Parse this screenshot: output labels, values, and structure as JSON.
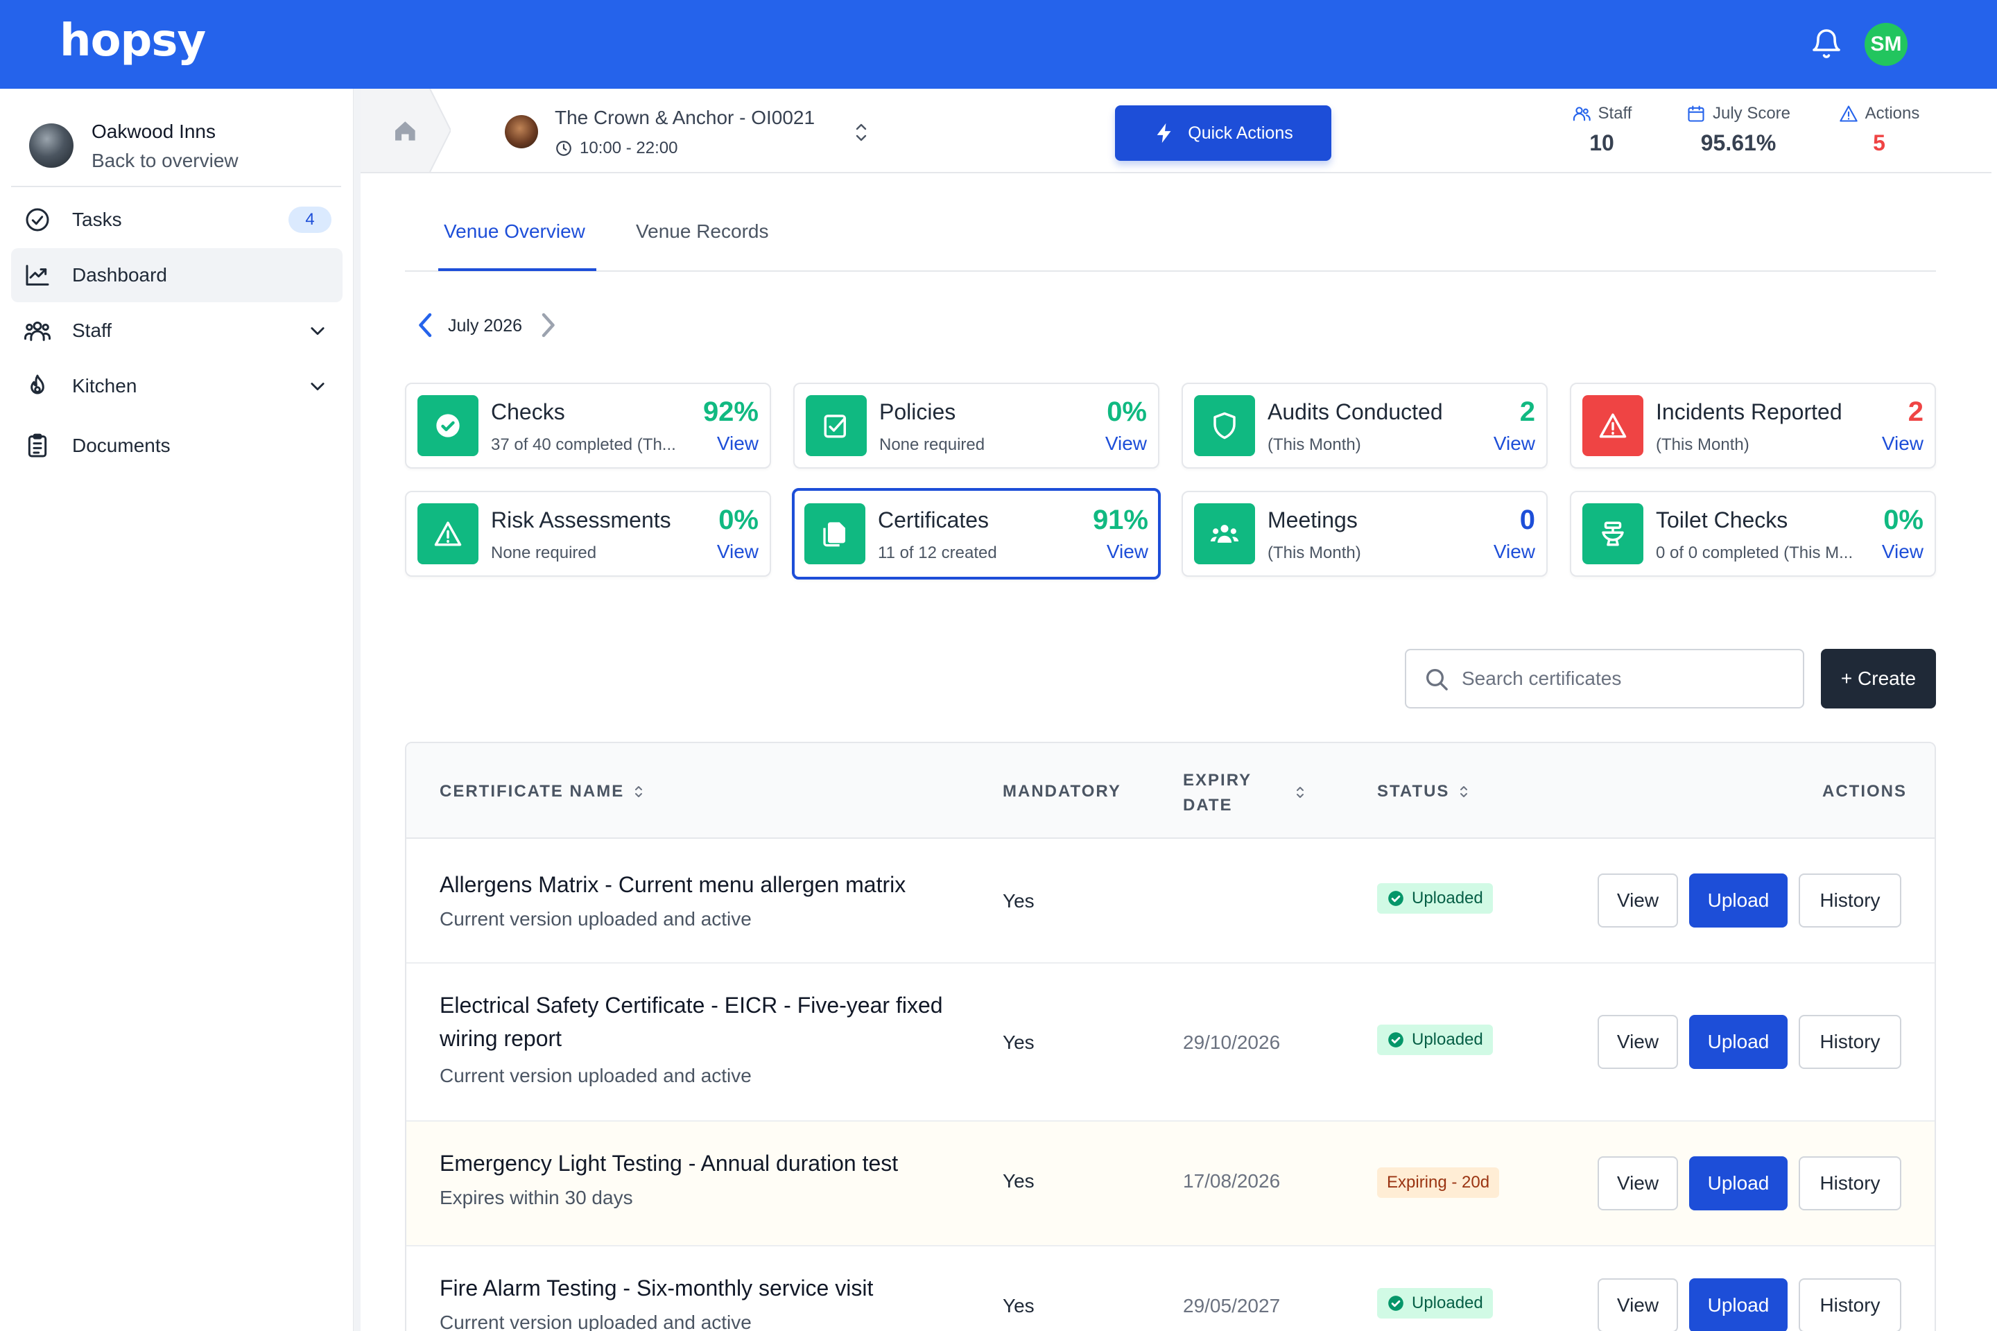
{
  "app": {
    "logo": "hopsy"
  },
  "topbar": {
    "user_initials": "SM"
  },
  "sidebar": {
    "org_name": "Oakwood Inns",
    "back_label": "Back to overview",
    "items": [
      {
        "label": "Tasks",
        "icon": "check-circle-icon",
        "badge": "4"
      },
      {
        "label": "Dashboard",
        "icon": "chart-line-icon"
      },
      {
        "label": "Staff",
        "icon": "users-icon"
      },
      {
        "label": "Kitchen",
        "icon": "flame-icon"
      },
      {
        "label": "Documents",
        "icon": "clipboard-icon"
      }
    ]
  },
  "venue": {
    "name": "The Crown & Anchor - OI0021",
    "hours": "10:00 - 22:00",
    "quick_actions_label": "Quick Actions",
    "stats": [
      {
        "label": "Staff",
        "value": "10",
        "icon": "users-icon"
      },
      {
        "label": "July Score",
        "value": "95.61%",
        "icon": "calendar-icon"
      },
      {
        "label": "Actions",
        "value": "5",
        "icon": "warning-icon",
        "color": "#ef4444"
      }
    ]
  },
  "tabs": [
    {
      "label": "Venue Overview",
      "active": true
    },
    {
      "label": "Venue Records",
      "active": false
    }
  ],
  "month_label": "July 2026",
  "cards": [
    {
      "title": "Checks",
      "subtitle": "37 of 40 completed (Th...",
      "value": "92%",
      "link": "View",
      "icon": "check-badge-icon",
      "color": "#10b981"
    },
    {
      "title": "Policies",
      "subtitle": "None required",
      "value": "0%",
      "link": "View",
      "icon": "checklist-icon",
      "color": "#10b981"
    },
    {
      "title": "Audits Conducted",
      "subtitle": "(This Month)",
      "value": "2",
      "link": "View",
      "icon": "shield-icon",
      "color": "#10b981"
    },
    {
      "title": "Incidents Reported",
      "subtitle": "(This Month)",
      "value": "2",
      "link": "View",
      "icon": "alert-icon",
      "color": "#ef4444"
    },
    {
      "title": "Risk Assessments",
      "subtitle": "None required",
      "value": "0%",
      "link": "View",
      "icon": "alert-icon",
      "color": "#10b981"
    },
    {
      "title": "Certificates",
      "subtitle": "11 of 12 created",
      "value": "91%",
      "link": "View",
      "icon": "documents-icon",
      "color": "#10b981"
    },
    {
      "title": "Meetings",
      "subtitle": "(This Month)",
      "value": "0",
      "link": "View",
      "icon": "group-icon",
      "color": "#10b981"
    },
    {
      "title": "Toilet Checks",
      "subtitle": "0 of 0 completed (This M...",
      "value": "0%",
      "link": "View",
      "icon": "toilet-icon",
      "color": "#10b981"
    }
  ],
  "search": {
    "placeholder": "Search certificates"
  },
  "create_label": "+ Create",
  "table": {
    "headers": {
      "name": "CERTIFICATE NAME",
      "mandatory": "MANDATORY",
      "expiry_line1": "EXPIRY",
      "expiry_line2": "DATE",
      "status": "STATUS",
      "actions": "ACTIONS"
    },
    "rows": [
      {
        "name": "Allergens Matrix - Current menu allergen matrix",
        "desc": "Current version uploaded and active",
        "mandatory": "Yes",
        "expiry": "",
        "status": "Uploaded",
        "status_type": "ok"
      },
      {
        "name": "Electrical Safety Certificate - EICR - Five-year fixed wiring report",
        "desc": "Current version uploaded and active",
        "mandatory": "Yes",
        "expiry": "29/10/2026",
        "status": "Uploaded",
        "status_type": "ok"
      },
      {
        "name": "Emergency Light Testing - Annual duration test",
        "desc": "Expires within 30 days",
        "mandatory": "Yes",
        "expiry": "17/08/2026",
        "status": "Expiring - 20d",
        "status_type": "expiring"
      },
      {
        "name": "Fire Alarm Testing - Six-monthly service visit",
        "desc": "Current version uploaded and active",
        "mandatory": "Yes",
        "expiry": "29/05/2027",
        "status": "Uploaded",
        "status_type": "ok"
      }
    ],
    "actions": {
      "view": "View",
      "upload": "Upload",
      "history": "History"
    }
  },
  "colors": {
    "brand": "#2563eb",
    "primary": "#1d4ed8",
    "success": "#10b981",
    "danger": "#ef4444"
  }
}
